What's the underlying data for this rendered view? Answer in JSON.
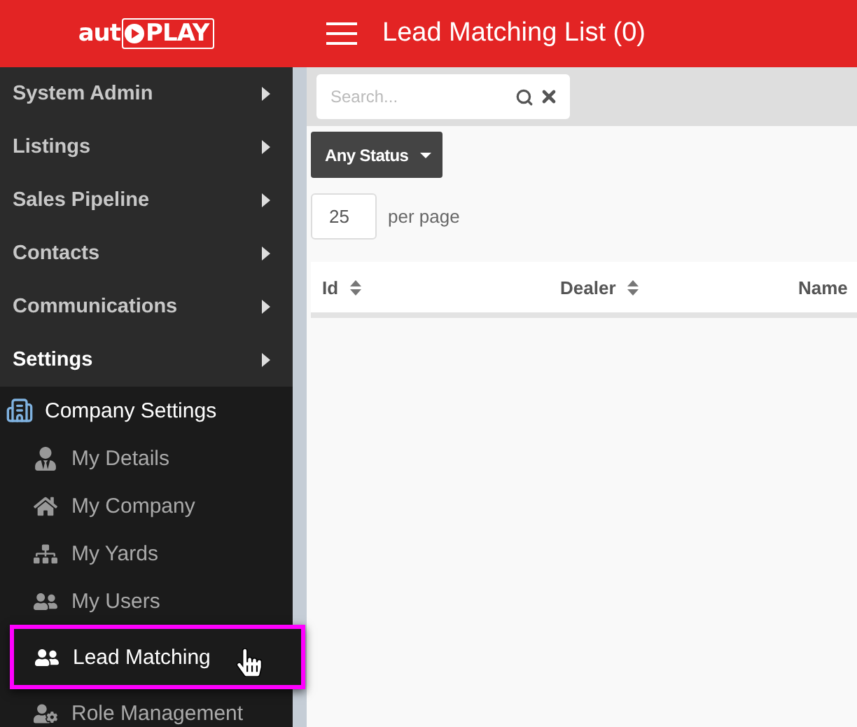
{
  "header": {
    "logo": {
      "prefix": "aut",
      "suffix": "PLAY"
    },
    "title": "Lead Matching List (0)"
  },
  "sidebar": {
    "items": [
      {
        "label": "System Admin",
        "expanded": false
      },
      {
        "label": "Listings",
        "expanded": false
      },
      {
        "label": "Sales Pipeline",
        "expanded": false
      },
      {
        "label": "Contacts",
        "expanded": false
      },
      {
        "label": "Communications",
        "expanded": false
      },
      {
        "label": "Settings",
        "expanded": true,
        "children": [
          {
            "label": "Company Settings",
            "children": [
              {
                "label": "My Details",
                "selected": false
              },
              {
                "label": "My Company",
                "selected": false
              },
              {
                "label": "My Yards",
                "selected": false
              },
              {
                "label": "My Users",
                "selected": false
              },
              {
                "label": "Lead Matching",
                "selected": true
              },
              {
                "label": "Role Management",
                "selected": false
              }
            ]
          }
        ]
      }
    ]
  },
  "search": {
    "placeholder": "Search..."
  },
  "status_filter": {
    "label": "Any Status"
  },
  "page_size": {
    "value": "25",
    "label": "per page"
  },
  "table": {
    "columns": [
      {
        "label": "Id"
      },
      {
        "label": "Dealer"
      },
      {
        "label": "Name"
      }
    ]
  }
}
